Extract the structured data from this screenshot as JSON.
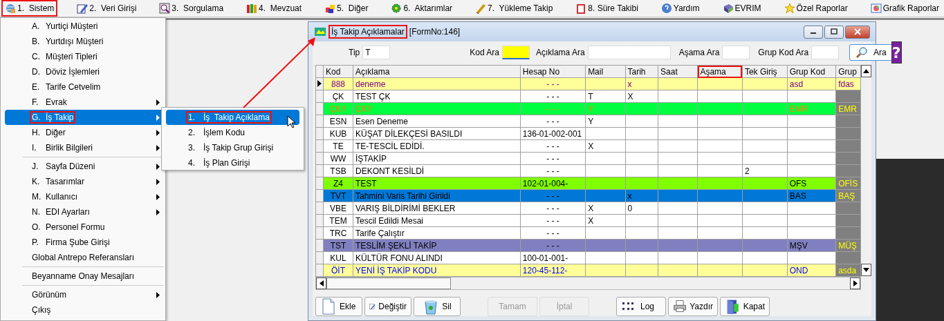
{
  "menubar": [
    {
      "label": "1.  Sistem",
      "annotated": true
    },
    {
      "label": "2.  Veri Girişi",
      "annotated": false
    },
    {
      "label": "3.  Sorgulama",
      "annotated": false
    },
    {
      "label": "4.  Mevzuat",
      "annotated": false
    },
    {
      "label": "5.  Diğer",
      "annotated": false
    },
    {
      "label": "6.  Aktarımlar",
      "annotated": false
    },
    {
      "label": "7.  Yükleme Takip",
      "annotated": false
    },
    {
      "label": "8. Süre Takibi",
      "annotated": false
    },
    {
      "label": "Yardım",
      "annotated": false
    },
    {
      "label": "EVRIM",
      "annotated": false
    },
    {
      "label": "Özel Raporlar",
      "annotated": false
    },
    {
      "label": "Grafik Raporlar",
      "annotated": false
    }
  ],
  "menu": {
    "sections": [
      [
        {
          "key": "A.",
          "label": "Yurtiçi Müşteri",
          "submenu": false,
          "selected": false,
          "annotated": false
        },
        {
          "key": "B.",
          "label": "Yurtdışı Müşteri",
          "submenu": false,
          "selected": false,
          "annotated": false
        },
        {
          "key": "C.",
          "label": "Müşteri Tipleri",
          "submenu": false,
          "selected": false,
          "annotated": false
        },
        {
          "key": "D.",
          "label": "Döviz İşlemleri",
          "submenu": false,
          "selected": false,
          "annotated": false
        },
        {
          "key": "E.",
          "label": "Tarife Cetvelim",
          "submenu": false,
          "selected": false,
          "annotated": false
        },
        {
          "key": "F.",
          "label": "Evrak",
          "submenu": true,
          "selected": false,
          "annotated": false
        },
        {
          "key": "G.",
          "label": "İş Takip",
          "submenu": true,
          "selected": true,
          "annotated": true
        },
        {
          "key": "H.",
          "label": "Diğer",
          "submenu": true,
          "selected": false,
          "annotated": false
        },
        {
          "key": "I.",
          "label": "Birlik Bilgileri",
          "submenu": true,
          "selected": false,
          "annotated": false
        }
      ],
      [
        {
          "key": "J.",
          "label": "Sayfa Düzeni",
          "submenu": true,
          "selected": false,
          "annotated": false
        },
        {
          "key": "K.",
          "label": "Tasarımlar",
          "submenu": true,
          "selected": false,
          "annotated": false
        },
        {
          "key": "M.",
          "label": "Kullanıcı",
          "submenu": true,
          "selected": false,
          "annotated": false
        },
        {
          "key": "N.",
          "label": "EDI Ayarları",
          "submenu": true,
          "selected": false,
          "annotated": false
        },
        {
          "key": "O.",
          "label": "Personel Formu",
          "submenu": false,
          "selected": false,
          "annotated": false
        },
        {
          "key": "P.",
          "label": "Firma Şube Girişi",
          "submenu": false,
          "selected": false,
          "annotated": false
        },
        {
          "label": "Global Antrepo Referansları",
          "submenu": false,
          "selected": false,
          "annotated": false
        }
      ],
      [
        {
          "label": "Beyanname Onay Mesajları",
          "submenu": false,
          "selected": false,
          "annotated": false
        }
      ],
      [
        {
          "label": "Görünüm",
          "submenu": true,
          "selected": false,
          "annotated": false
        },
        {
          "label": "Çıkış",
          "submenu": false,
          "selected": false,
          "annotated": false
        }
      ]
    ]
  },
  "submenu": {
    "items": [
      {
        "key": "1.",
        "label": "İş  Takip Açıklama",
        "selected": true,
        "annotated": true
      },
      {
        "key": "2.",
        "label": "İşlem Kodu",
        "selected": false,
        "annotated": false
      },
      {
        "key": "3.",
        "label": "İş Takip Grup Girişi",
        "selected": false,
        "annotated": false
      },
      {
        "key": "4.",
        "label": "İş Plan Girişi",
        "selected": false,
        "annotated": false
      }
    ]
  },
  "window": {
    "title": "İş Takip Açıklamalar",
    "title_annotated": true,
    "form_no": "[FormNo:146]"
  },
  "filters": [
    {
      "label": "Tip",
      "value": "T",
      "focused": false
    },
    {
      "label": "Kod Ara",
      "focused": true
    },
    {
      "label": "Açıklama Ara",
      "focused": false
    },
    {
      "label": "Aşama Ara",
      "focused": false
    },
    {
      "label": "Grup Kod Ara",
      "focused": false
    }
  ],
  "search_button": "Ara",
  "help_button": "?",
  "table": {
    "columns": [
      {
        "label": "Kod",
        "annotated": false
      },
      {
        "label": "Açıklama",
        "annotated": false
      },
      {
        "label": "Hesap No",
        "annotated": false
      },
      {
        "label": "Mail",
        "annotated": false
      },
      {
        "label": "Tarih",
        "annotated": false
      },
      {
        "label": "Saat",
        "annotated": false
      },
      {
        "label": "Aşama",
        "annotated": true
      },
      {
        "label": "Tek Giriş",
        "annotated": false
      },
      {
        "label": "Grup Kod",
        "annotated": false
      },
      {
        "label": "Grup",
        "annotated": false
      }
    ],
    "rows": [
      {
        "current": true,
        "color": "#ffff99",
        "kind": "violet",
        "cells": [
          "888",
          "deneme",
          "- - -",
          "",
          "x",
          "",
          "",
          "",
          "asd",
          "fdas"
        ]
      },
      {
        "current": false,
        "color": "#ffffff",
        "kind": "plain",
        "grup_cell": {
          "color": "#808080"
        },
        "cells": [
          "ÇK",
          "TEST ÇK",
          "- - -",
          "T",
          "X",
          "",
          "",
          "",
          "",
          ""
        ]
      },
      {
        "current": false,
        "color": "#00ff40",
        "kind": "orange",
        "grup_cell": {
          "color": "#808080"
        },
        "cells": [
          "ÇKY",
          "ÇKY",
          "- - -",
          "Y",
          "",
          "",
          "",
          "",
          "EMR",
          "EMR"
        ]
      },
      {
        "current": false,
        "color": "#ffffff",
        "kind": "plain",
        "grup_cell": {
          "color": "#808080"
        },
        "cells": [
          "ESN",
          "Esen Deneme",
          "- - -",
          "Y",
          "",
          "",
          "",
          "",
          "",
          ""
        ]
      },
      {
        "current": false,
        "color": "#ffffff",
        "kind": "plain",
        "grup_cell": {
          "color": "#808080"
        },
        "cells": [
          "KUB",
          "KÜŞAT DİLEKÇESİ BASILDI",
          "136-01-002-001",
          "",
          "",
          "",
          "",
          "",
          "",
          ""
        ]
      },
      {
        "current": false,
        "color": "#ffffff",
        "kind": "plain",
        "grup_cell": {
          "color": "#808080"
        },
        "cells": [
          "TE",
          "TE-TESCİL EDİDİ.",
          "- - -",
          "X",
          "",
          "",
          "",
          "",
          "",
          ""
        ]
      },
      {
        "current": false,
        "color": "#ffffff",
        "kind": "plain",
        "grup_cell": {
          "color": "#808080"
        },
        "cells": [
          "WW",
          "İŞTAKİP",
          "- - -",
          "",
          "",
          "",
          "",
          "",
          "",
          ""
        ]
      },
      {
        "current": false,
        "color": "#ffffff",
        "kind": "plain",
        "grup_cell": {
          "color": "#808080"
        },
        "cells": [
          "TSB",
          "DEKONT KESİLDİ",
          "- - -",
          "",
          "",
          "",
          "",
          "2",
          "",
          ""
        ]
      },
      {
        "current": false,
        "color": "#80ff00",
        "kind": "plain",
        "grup_cell": {
          "color": "#808080"
        },
        "cells": [
          "Z4",
          "TEST",
          "102-01-004-",
          "",
          "",
          "",
          "",
          "",
          "OFS",
          "OFİS"
        ]
      },
      {
        "current": false,
        "color": "#0078d7",
        "kind": "plain",
        "grup_cell": {
          "color": "#808080"
        },
        "cells": [
          "TVT",
          "Tahmini Varis Tarihi Girildi",
          "- - -",
          "",
          "x",
          "",
          "",
          "",
          "BAS",
          "BAŞ"
        ]
      },
      {
        "current": false,
        "color": "#ffffff",
        "kind": "plain",
        "grup_cell": {
          "color": "#808080"
        },
        "cells": [
          "VBE",
          "VARIŞ BİLDİRİMİ BEKLER",
          "- - -",
          "X",
          "0",
          "",
          "",
          "",
          "",
          ""
        ]
      },
      {
        "current": false,
        "color": "#ffffff",
        "kind": "plain",
        "grup_cell": {
          "color": "#808080"
        },
        "cells": [
          "TEM",
          "Tescil Edildi Mesai",
          "- - -",
          "X",
          "",
          "",
          "",
          "",
          "",
          ""
        ]
      },
      {
        "current": false,
        "color": "#ffffff",
        "kind": "plain",
        "grup_cell": {
          "color": "#808080"
        },
        "cells": [
          "TRC",
          "Tarife Çalıştır",
          "- - -",
          "",
          "",
          "",
          "",
          "",
          "",
          ""
        ]
      },
      {
        "current": false,
        "color": "#8080c0",
        "kind": "plain",
        "grup_cell": {
          "color": "#808080"
        },
        "cells": [
          "TST",
          "TESLİM ŞEKLİ TAKİP",
          "- - -",
          "",
          "",
          "",
          "",
          "",
          "MŞV",
          "MÜŞ"
        ]
      },
      {
        "current": false,
        "color": "#ffffff",
        "kind": "plain",
        "grup_cell": {
          "color": "#808080"
        },
        "cells": [
          "KUL",
          "KÜLTÜR FONU ALINDI",
          "100-01-001-",
          "",
          "",
          "",
          "",
          "",
          "",
          ""
        ]
      },
      {
        "current": false,
        "color": "#ffff99",
        "kind": "blue",
        "grup_cell": {
          "color": "#808080"
        },
        "cells": [
          "ÖİT",
          "YENİ İŞ TAKİP KODU",
          "120-45-112-",
          "",
          "",
          "",
          "",
          "",
          "OND",
          "asda"
        ]
      }
    ]
  },
  "buttons": [
    {
      "label": "Ekle",
      "disabled": false
    },
    {
      "label": "Değiştir",
      "disabled": false
    },
    {
      "label": "Sil",
      "disabled": false
    },
    {
      "label": "Tamam",
      "disabled": true
    },
    {
      "label": "İptal",
      "disabled": true
    },
    {
      "label": "Log",
      "disabled": false
    },
    {
      "label": "Yazdır",
      "disabled": false
    },
    {
      "label": "Kapat",
      "disabled": false
    }
  ]
}
